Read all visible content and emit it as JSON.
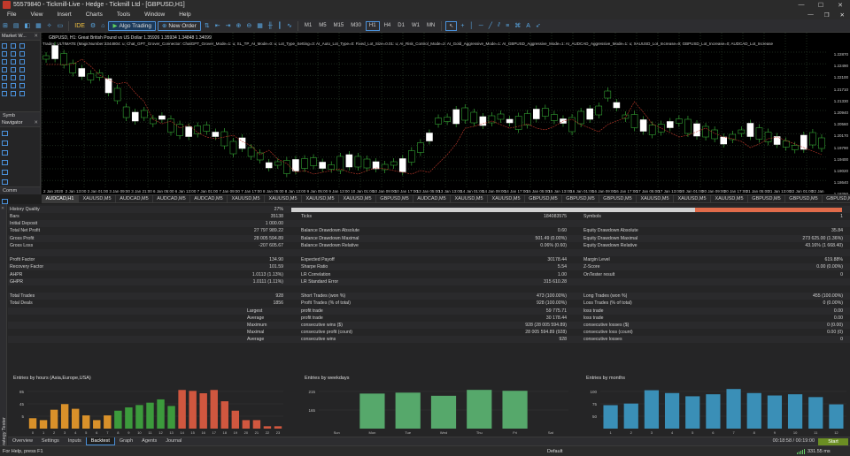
{
  "window": {
    "title": "55579840 - Tickmill-Live - Hedge - Tickmill Ltd - [GBPUSD,H1]"
  },
  "menu": [
    "File",
    "View",
    "Insert",
    "Charts",
    "Tools",
    "Window",
    "Help"
  ],
  "toolbar": {
    "algo_trading": "Algo Trading",
    "new_order": "New Order",
    "timeframes": [
      "M1",
      "M5",
      "M15",
      "M30",
      "H1",
      "H4",
      "D1",
      "W1",
      "MN"
    ],
    "active_timeframe": "H1"
  },
  "market_watch": {
    "title": "Market W...",
    "symbol_tab": "Symb"
  },
  "navigator": {
    "title": "Navigator",
    "common_tab": "Comm"
  },
  "chart": {
    "symbol_line": "GBPUSD, H1:  Great British Pound vs US Dollar  1.35926 1.35934 1.34848 1.34099",
    "params_line": "Tradex_ULTIMATE (MagicNumber:3344804: u; Chat_GPT_Grover_Connector: ChatGPT_Grover_Mode=1: u; SL_TP_AI_Mode=0: u; Lot_Type_Setting=3: AI_Auto_Lot_Type=0: Fixed_Lot_Size=0.01: u; AI_Risk_Control_Mode=2: AI_Gold_Aggressive_Mode=1: AI_GBPUSD_Aggressive_Mode=1: AI_AUDCAD_Aggressive_Mode=1: u; XAUUSD_Lot_Increase=0; GBPUSD_Lot_Increase=0; AUDCAD_Lot_Increase",
    "price_ticks": [
      "1.22870",
      "1.22490",
      "1.22100",
      "1.21710",
      "1.21330",
      "1.20940",
      "1.20560",
      "1.20170",
      "1.19790",
      "1.19400",
      "1.19020",
      "1.18640",
      "1.18250"
    ],
    "price_ticks_labels": [
      "1.22870",
      "1.22490",
      "1.22100",
      "1.21710",
      "1.21330",
      "1.20940",
      "1.20560",
      "1.20170",
      "1.19790",
      "1.19400",
      "1.19020",
      "1.18640",
      "1.18250"
    ],
    "time_ticks": [
      "2 Jan 2020",
      "2 Jan 05:00",
      "3 Jan 01:00",
      "3 Jan 09:00",
      "3 Jan 17:00",
      "4 Jan 01:00",
      "5 Jan 09:00",
      "5 Jan 17:00",
      "6 Jan 01:00",
      "6 Jan 09:00",
      "6 Jan 17:00",
      "7 Jan 01:00",
      "7 Jan 09:00",
      "7 Jan 17:00",
      "8 Jan 01:00",
      "8 Jan 09:00",
      "8 Jan 17:00",
      "9 Jan 01:00",
      "9 Jan 09:00",
      "9 Jan 17:00",
      "10 Jan 01:00",
      "10 Jan 09:00",
      "10 Jan 17:00",
      "11 Jan 01:00",
      "11 Jan 09:00",
      "11 Jan 17:00",
      "12 Jan 01:00",
      "12 Jan 09:00",
      "12 Jan 17:00",
      "13 Jan 01:00",
      "13 Jan 09:00",
      "13 Jan 17:00",
      "14 Jan 01:00",
      "14 Jan 09:00",
      "14 Jan 17:00",
      "15 Jan 01:00",
      "15 Jan 09:00",
      "15 Jan 17:00",
      "16 Jan 01:00",
      "16 Jan 09:00",
      "16 Jan 17:00",
      "17 Jan 01:00",
      "17 Jan 09:00",
      "17 Jan 17:00",
      "18 Jan 01:00",
      "18 Jan 09:00",
      "18 Jan 17:00",
      "19 Jan 01:00",
      "19 Jan 09:00",
      "19 Jan 17:00",
      "20 Jan 01:00",
      "20 Jan 09:00",
      "20 Jan 17:00",
      "21 Jan 01:00",
      "21 Jan 09:00",
      "21 Jan 17:00",
      "22 Jan 01:00",
      "22 Jan 09:00"
    ],
    "time_labels": [
      "2 Jan 2020",
      "2 Jan 05:00",
      "2 Jan 13:00",
      "2 Jan 17:00",
      "3 Jan 01:00",
      "3 Jan 05:00",
      "3 Jan 09:00",
      "3 Jan 13:00",
      "3 Jan 21:00",
      "6 Jan 01:00",
      "6 Jan 05:00",
      "6 Jan 09:00",
      "6 Jan 13:00",
      "6 Jan 17:00",
      "7 Jan 01:00",
      "7 Jan 05:00",
      "7 Jan 09:00",
      "7 Jan 13:00",
      "7 Jan 17:00",
      "8 Jan 01:00",
      "8 Jan 05:00",
      "8 Jan 09:00",
      "8 Jan 13:00",
      "9 Jan 01:00",
      "9 Jan 05:00",
      "9 Jan 09:00",
      "9 Jan 13:00",
      "9 Jan 21:00",
      "10 Jan 01:00",
      "10 Jan 05:00",
      "10 Jan 09:00",
      "10 Jan 13:00",
      "10 Jan 17:00",
      "13 Jan 01:00",
      "13 Jan 05:00",
      "13 Jan 09:00",
      "13 Jan 13:00",
      "13 Jan 17:00",
      "14 Jan 01:00",
      "14 Jan 05:00",
      "14 Jan 09:00",
      "14 Jan 13:00",
      "14 Jan 17:00",
      "15 Jan 01:00",
      "15 Jan 05:00",
      "15 Jan 09:00",
      "15 Jan 13:00",
      "15 Jan 17:00",
      "16 Jan 01:00",
      "16 Jan 05:00",
      "16 Jan 09:00",
      "16 Jan 13:00",
      "16 Jan 17:00",
      "17 Jan 01:00",
      "17 Jan 05:00",
      "17 Jan 09:00",
      "17 Jan 13:00",
      "17 Jan 17:00",
      "20 Jan 01:00",
      "20 Jan 05:00",
      "20 Jan 09:00",
      "20 Jan 13:00",
      "20 Jan 17:00",
      "21 Jan 01:00",
      "21 Jan 05:00",
      "21 Jan 09:00",
      "21 Jan 13:00",
      "21 Jan 17:00",
      "22 Jan 01:00",
      "22 Jan 05:00",
      "22 Jan 09:00",
      "22 Jan 12:00"
    ]
  },
  "symbol_tabs": [
    "AUDCAD,H1",
    "XAUUSD,M5",
    "AUDCAD,M5",
    "AUDCAD,M5",
    "AUDCAD,M5",
    "XAUUSD,M5",
    "XAUUSD,M5",
    "XAUUSD,M5",
    "XAUUSD,M5",
    "GBPUSD,M5",
    "AUDCAD,M5",
    "XAUUSD,M5",
    "XAUUSD,M5",
    "GBPUSD,M5",
    "GBPUSD,M5",
    "GBPUSD,M5",
    "XAUUSD,M5",
    "XAUUSD,M5",
    "XAUUSD,M5",
    "GBPUSD,M5",
    "GBPUSD,M5",
    "GBPUSD,M5"
  ],
  "report": {
    "history_quality": {
      "label": "History Quality",
      "value": "27%"
    },
    "rows": [
      {
        "c1": [
          "Bars",
          "35138"
        ],
        "c2": [
          "Ticks",
          "184083575"
        ],
        "c3": [
          "Symbols",
          "1"
        ]
      },
      {
        "c1": [
          "Initial Deposit",
          "1 000.00"
        ],
        "c2": [
          "",
          ""
        ],
        "c3": [
          "",
          ""
        ]
      },
      {
        "c1": [
          "Total Net Profit",
          "27 797 989.22"
        ],
        "c2": [
          "Balance Drawdown Absolute",
          "0.60"
        ],
        "c3": [
          "Equity Drawdown Absolute",
          "35.84"
        ]
      },
      {
        "c1": [
          "Gross Profit",
          "28 005 594.89"
        ],
        "c2": [
          "Balance Drawdown Maximal",
          "501.49 (0.00%)"
        ],
        "c3": [
          "Equity Drawdown Maximal",
          "273 625.00 (1.36%)"
        ]
      },
      {
        "c1": [
          "Gross Loss",
          "-207 605.67"
        ],
        "c2": [
          "Balance Drawdown Relative",
          "0.06% (0.60)"
        ],
        "c3": [
          "Equity Drawdown Relative",
          "43.16% (1 668.40)"
        ]
      },
      {
        "c1": [
          "",
          ""
        ],
        "c2": [
          "",
          ""
        ],
        "c3": [
          "",
          ""
        ]
      },
      {
        "c1": [
          "Profit Factor",
          "134.90"
        ],
        "c2": [
          "Expected Payoff",
          "30178.44"
        ],
        "c3": [
          "Margin Level",
          "619.88%"
        ]
      },
      {
        "c1": [
          "Recovery Factor",
          "101.59"
        ],
        "c2": [
          "Sharpe Ratio",
          "5.54"
        ],
        "c3": [
          "Z-Score",
          "0.00 (0.00%)"
        ]
      },
      {
        "c1": [
          "AHPR",
          "1.0113 (1.13%)"
        ],
        "c2": [
          "LR Correlation",
          "1.00"
        ],
        "c3": [
          "OnTester result",
          "0"
        ]
      },
      {
        "c1": [
          "GHPR",
          "1.0111 (1.11%)"
        ],
        "c2": [
          "LR Standard Error",
          "315 610.28"
        ],
        "c3": [
          "",
          ""
        ]
      },
      {
        "c1": [
          "",
          ""
        ],
        "c2": [
          "",
          ""
        ],
        "c3": [
          "",
          ""
        ]
      },
      {
        "c1": [
          "Total Trades",
          "928"
        ],
        "c2": [
          "Short Trades (won %)",
          "473 (100.00%)"
        ],
        "c3": [
          "Long Trades (won %)",
          "455 (100.00%)"
        ]
      },
      {
        "c1": [
          "Total Deals",
          "1856"
        ],
        "c2": [
          "Profit Trades (% of total)",
          "928 (100.00%)"
        ],
        "c3": [
          "Loss Trades (% of total)",
          "0 (0.00%)"
        ]
      },
      {
        "c1": [
          "Largest",
          ""
        ],
        "c2": [
          "profit trade",
          "59 775.71"
        ],
        "c3": [
          "loss trade",
          "0.00"
        ]
      },
      {
        "c1": [
          "Average",
          ""
        ],
        "c2": [
          "profit trade",
          "30 178.44"
        ],
        "c3": [
          "loss trade",
          "0.00"
        ]
      },
      {
        "c1": [
          "Maximum",
          ""
        ],
        "c2": [
          "consecutive wins ($)",
          "928 (28 005 594.89)"
        ],
        "c3": [
          "consecutive losses ($)",
          "0 (0.00)"
        ]
      },
      {
        "c1": [
          "Maximal",
          ""
        ],
        "c2": [
          "consecutive profit (count)",
          "28 005 594.89 (928)"
        ],
        "c3": [
          "consecutive loss (count)",
          "0.00 (0)"
        ]
      },
      {
        "c1": [
          "Average",
          ""
        ],
        "c2": [
          "consecutive wins",
          "928"
        ],
        "c3": [
          "consecutive losses",
          "0"
        ]
      }
    ]
  },
  "mini_charts": {
    "hours": {
      "title": "Entries by hours (Asia,Europe,USA)",
      "yticks": [
        "85",
        "45",
        "5"
      ],
      "xticks": [
        "0",
        "1",
        "2",
        "3",
        "4",
        "5",
        "6",
        "7",
        "8",
        "9",
        "10",
        "11",
        "12",
        "13",
        "14",
        "15",
        "16",
        "17",
        "18",
        "19",
        "20",
        "21",
        "22",
        "23"
      ],
      "values": [
        22,
        18,
        40,
        52,
        42,
        28,
        18,
        28,
        38,
        45,
        50,
        55,
        62,
        48,
        82,
        80,
        75,
        82,
        58,
        38,
        18,
        18,
        5,
        5
      ]
    },
    "weekdays": {
      "title": "Entries by weekdays",
      "yticks": [
        "215",
        "165"
      ],
      "xticks": [
        "Sun",
        "Mon",
        "Tue",
        "Wed",
        "Thu",
        "Fri",
        "Sat"
      ],
      "values": [
        0,
        190,
        195,
        178,
        210,
        205,
        0
      ]
    },
    "months": {
      "title": "Entries by months",
      "yticks": [
        "100",
        "75",
        "50"
      ],
      "xticks": [
        "1",
        "2",
        "3",
        "4",
        "5",
        "6",
        "7",
        "8",
        "9",
        "10",
        "11",
        "12"
      ],
      "values": [
        58,
        62,
        95,
        88,
        80,
        85,
        98,
        88,
        82,
        85,
        78,
        60
      ]
    }
  },
  "tabs": [
    "Overview",
    "Settings",
    "Inputs",
    "Backtest",
    "Graph",
    "Agents",
    "Journal"
  ],
  "active_tab": "Backtest",
  "timer": "00:18:58 / 00:19:00",
  "start_button": "Start",
  "side_label": "Strategy Tester",
  "status": {
    "help": "For Help, press F1",
    "profile": "Default",
    "ping": "331.55 ms"
  }
}
